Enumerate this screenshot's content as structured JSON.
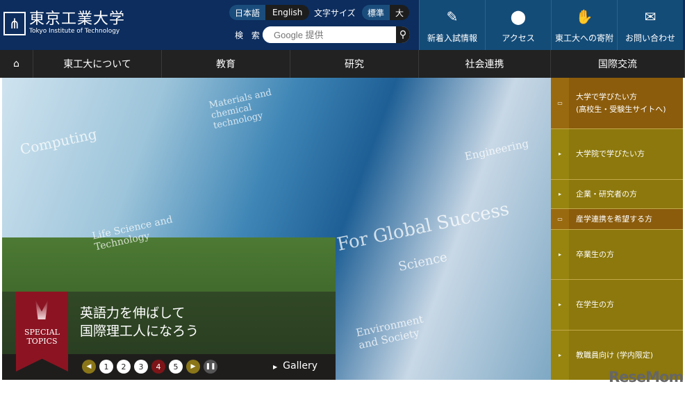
{
  "header": {
    "logo_jp": "東京工業大学",
    "logo_en": "Tokyo Institute of Technology",
    "lang": [
      "日本語",
      "English"
    ],
    "font_size_label": "文字サイズ",
    "font_sizes": [
      "標準",
      "大"
    ],
    "search_label": "検 索",
    "search_placeholder": "Google 提供",
    "quick": [
      {
        "icon": "pencil-icon",
        "label": "新着入試情報"
      },
      {
        "icon": "map-pin-icon",
        "label": "アクセス"
      },
      {
        "icon": "handshake-icon",
        "label": "東工大への寄附"
      },
      {
        "icon": "mail-icon",
        "label": "お問い合わせ"
      }
    ]
  },
  "nav": [
    "東工大について",
    "教育",
    "研究",
    "社会連携",
    "国際交流"
  ],
  "hero": {
    "overlay_words": [
      "Computing",
      "Materials and chemical technology",
      "Engineering",
      "Life Science and Technology",
      "For Global Success",
      "Science",
      "Environment and Society"
    ],
    "badge": [
      "SPECIAL",
      "TOPICS"
    ],
    "title": [
      "英語力を伸ばして",
      "国際理工人になろう"
    ],
    "pages": [
      "1",
      "2",
      "3",
      "4",
      "5"
    ],
    "current_page": 4,
    "gallery": "Gallery"
  },
  "side": [
    {
      "label": "大学で学びたい方",
      "sub": "(高校生・受験生サイトへ)"
    },
    {
      "label": "大学院で学びたい方"
    },
    {
      "label": "企業・研究者の方"
    },
    {
      "label": "産学連携を希望する方"
    },
    {
      "label": "卒業生の方"
    },
    {
      "label": "在学生の方"
    },
    {
      "label": "教職員向け (学内限定)"
    }
  ],
  "watermark": "ReseMom"
}
